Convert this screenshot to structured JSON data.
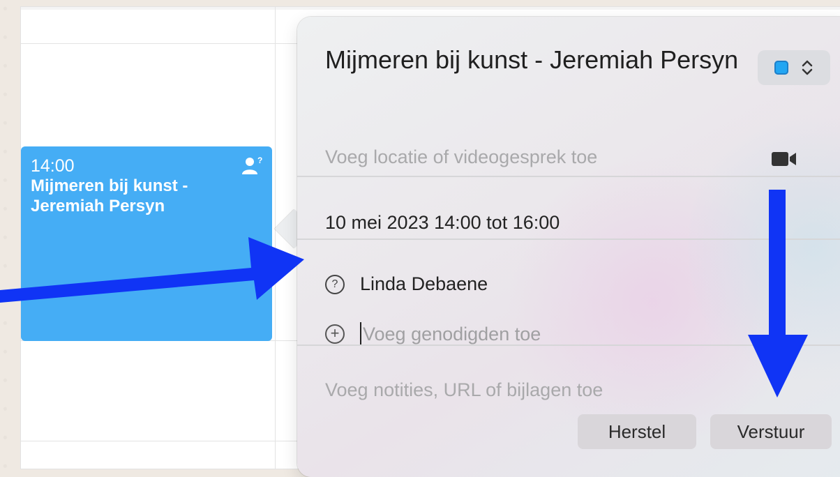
{
  "event": {
    "time": "14:00",
    "title": "Mijmeren bij kunst - Jeremiah Persyn",
    "color": "#45adf5",
    "status_icon": "person-question-icon"
  },
  "popover": {
    "title": "Mijmeren bij kunst - Jeremiah Persyn",
    "calendar_color": "#23a6f2",
    "location_placeholder": "Voeg locatie of videogesprek toe",
    "video_icon": "video-camera-icon",
    "date_time": "10 mei 2023  14:00 tot 16:00",
    "attendees": [
      {
        "name": "Linda Debaene",
        "status_icon": "question-circle-icon"
      }
    ],
    "add_guests_placeholder": "Voeg genodigden toe",
    "notes_placeholder": "Voeg notities, URL of bijlagen toe",
    "buttons": {
      "reset": "Herstel",
      "send": "Verstuur"
    }
  },
  "annotations": {
    "arrow_color": "#1034f5"
  }
}
